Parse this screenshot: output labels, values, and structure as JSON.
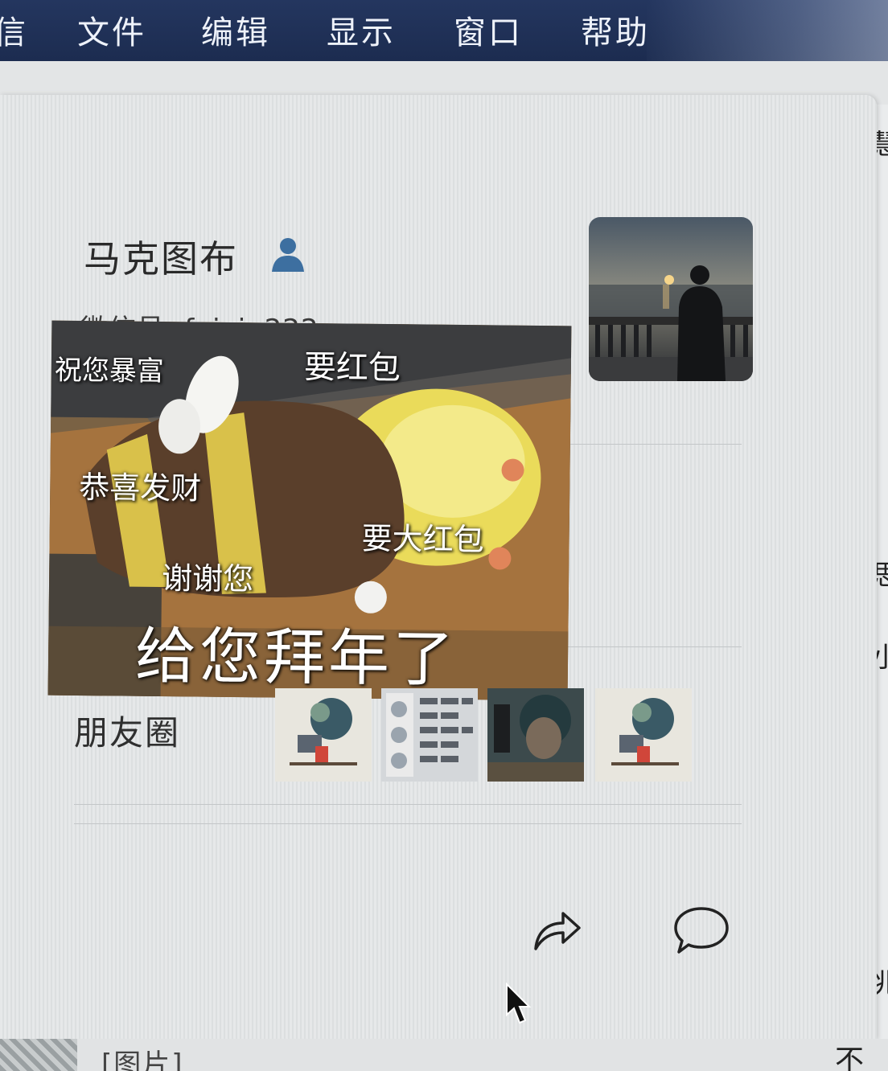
{
  "menubar": {
    "items": [
      "信",
      "文件",
      "编辑",
      "显示",
      "窗口",
      "帮助"
    ]
  },
  "profile": {
    "name": "马克图布",
    "wechat_id": "微信号: feixin222"
  },
  "sticker": {
    "captions": [
      "祝您暴富",
      "要红包",
      "恭喜发财",
      "要大红包",
      "谢谢您",
      "给您拜年了"
    ]
  },
  "moments": {
    "label": "朋友圈"
  },
  "bottom": {
    "preview_text": "[图片]",
    "right_text": "不行"
  },
  "edge": {
    "chars": [
      "慧",
      "思",
      "小",
      "兆"
    ]
  },
  "icons": {
    "share": "share-arrow-icon",
    "message": "chat-bubble-icon",
    "contact": "person-icon",
    "cursor": "mouse-cursor-icon"
  },
  "colors": {
    "menubar": "#1c2c50",
    "person_icon": "#3d6fa0"
  }
}
